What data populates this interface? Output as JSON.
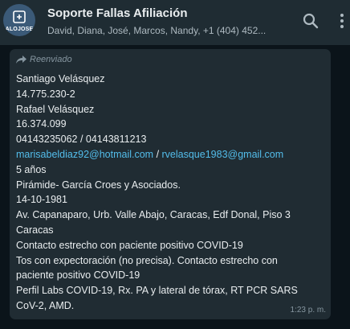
{
  "header": {
    "avatar_text": "ALOJOSE",
    "title": "Soporte Fallas Afiliación",
    "subtitle": "David, Diana, José, Marcos, Nandy, +1 (404) 452..."
  },
  "message": {
    "forwarded_label": "Reenviado",
    "lines": [
      "Santiago Velásquez",
      "14.775.230-2",
      "Rafael Velásquez",
      "16.374.099",
      "04143235062 / 04143811213"
    ],
    "email1": "marisabeldiaz92@hotmail.com",
    "email_sep": " / ",
    "email2": "rvelasque1983@gmail.com",
    "lines2": [
      "5 años",
      "Pirámide- García Croes y Asociados.",
      "14-10-1981",
      "Av. Capanaparo, Urb. Valle Abajo, Caracas, Edf Donal, Piso 3",
      "Caracas",
      "Contacto estrecho con paciente positivo COVID-19",
      "Tos con expectoración (no precisa). Contacto estrecho con",
      "paciente positivo COVID-19",
      "Perfil Labs COVID-19, Rx. PA y lateral de tórax, RT PCR SARS",
      "CoV-2, AMD."
    ],
    "time": "1:23 p. m."
  },
  "icons": {
    "search": "search-icon",
    "menu": "more-vertical-icon",
    "forward": "forward-arrow-icon"
  },
  "colors": {
    "header_bg": "#1f2c33",
    "bubble_bg": "#202c33",
    "link": "#53bdeb"
  }
}
